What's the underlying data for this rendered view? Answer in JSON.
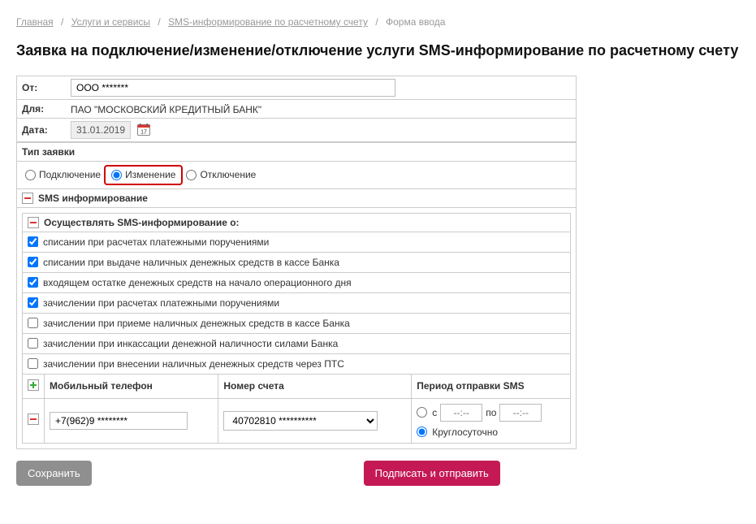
{
  "breadcrumb": {
    "items": [
      "Главная",
      "Услуги и сервисы",
      "SMS-информирование по расчетному счету"
    ],
    "current": "Форма ввода",
    "sep": "/"
  },
  "title": "Заявка на подключение/изменение/отключение услуги SMS-информирование по расчетному счету",
  "header": {
    "from_label": "От:",
    "from_value": "ООО *******",
    "for_label": "Для:",
    "for_value": "ПАО \"МОСКОВСКИЙ КРЕДИТНЫЙ БАНК\"",
    "date_label": "Дата:",
    "date_value": "31.01.2019"
  },
  "request_type": {
    "label": "Тип заявки",
    "options": [
      "Подключение",
      "Изменение",
      "Отключение"
    ],
    "selected": "Изменение"
  },
  "sms_section": {
    "title": "SMS информирование",
    "inform_header": "Осуществлять SMS-информирование о:",
    "options": [
      {
        "label": "списании при расчетах платежными поручениями",
        "checked": true
      },
      {
        "label": "списании при выдаче наличных денежных средств в кассе Банка",
        "checked": true
      },
      {
        "label": "входящем остатке денежных средств на начало операционного дня",
        "checked": true
      },
      {
        "label": "зачислении при расчетах платежными поручениями",
        "checked": true
      },
      {
        "label": "зачислении при приеме наличных денежных средств в кассе Банка",
        "checked": false
      },
      {
        "label": "зачислении при инкассации денежной наличности силами Банка",
        "checked": false
      },
      {
        "label": "зачислении при внесении наличных денежных средств через ПТС",
        "checked": false
      }
    ]
  },
  "table": {
    "headers": {
      "phone": "Мобильный телефон",
      "account": "Номер счета",
      "period": "Период отправки SMS"
    },
    "row": {
      "phone": "+7(962)9 ********",
      "account": "40702810 **********",
      "period": {
        "range_label_from": "с",
        "range_label_to": "по",
        "time_placeholder": "--:--",
        "all_day_label": "Круглосуточно",
        "selected": "all_day"
      }
    }
  },
  "buttons": {
    "save": "Сохранить",
    "submit": "Подписать и отправить"
  }
}
